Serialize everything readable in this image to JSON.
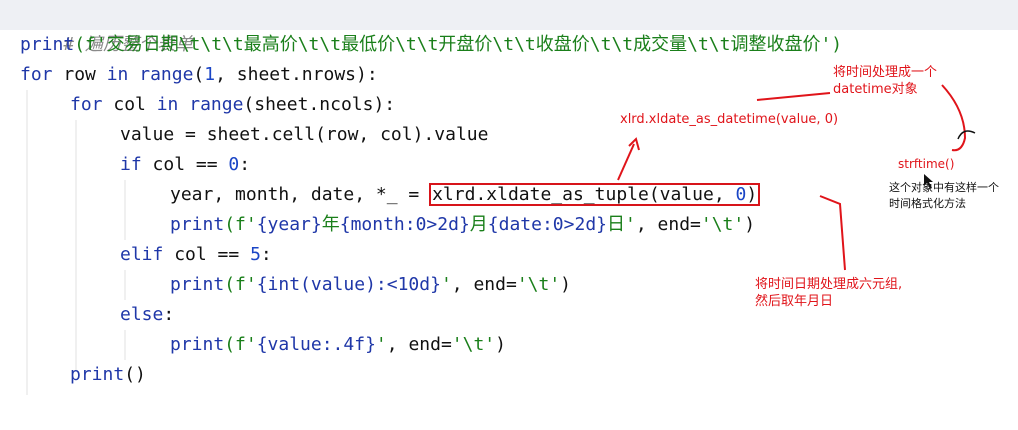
{
  "code": {
    "comment": "# 遍历整个表单",
    "print_header": {
      "fn": "print",
      "open": "(f'",
      "str": "交易日期\\t\\t\\t最高价\\t\\t最低价\\t\\t开盘价\\t\\t收盘价\\t\\t成交量\\t\\t调整收盘价",
      "close": "')"
    },
    "for_row": {
      "for": "for",
      "var": " row ",
      "in": "in",
      "range": " range",
      "args_a": "(",
      "one": "1",
      "args_b": ", sheet.nrows):"
    },
    "for_col": {
      "for": "for",
      "var": " col ",
      "in": "in",
      "range": " range",
      "args": "(sheet.ncols):"
    },
    "value_line": "value = sheet.cell(row, col).value",
    "if_col": {
      "kw": "if",
      "cond": " col == ",
      "zero": "0",
      "colon": ":"
    },
    "unpack": {
      "lhs": "year, month, date, *_ = ",
      "call": "xlrd.xldate_as_tuple(value, ",
      "zero": "0",
      "close": ")"
    },
    "print_date": {
      "fn": "print",
      "open": "(f'",
      "f1": "{year}",
      "s1": "年",
      "f2": "{month:0>2d}",
      "s2": "月",
      "f3": "{date:0>2d}",
      "s3": "日'",
      "mid": ", end=",
      "end_str": "'\\t'",
      "close": ")"
    },
    "elif_col": {
      "kw": "elif",
      "cond": " col == ",
      "five": "5",
      "colon": ":"
    },
    "print_int": {
      "fn": "print",
      "open": "(f'",
      "f1": "{int(value):<10d}",
      "s1": "'",
      "mid": ", end=",
      "end_str": "'\\t'",
      "close": ")"
    },
    "else_line": {
      "kw": "else",
      "colon": ":"
    },
    "print_value": {
      "fn": "print",
      "open": "(f'",
      "f1": "{value:.4f}",
      "s1": "'",
      "mid": ", end=",
      "end_str": "'\\t'",
      "close": ")"
    },
    "print_empty": {
      "fn": "print",
      "args": "()"
    }
  },
  "annotations": {
    "datetime_note_line1": "将时间处理成一个",
    "datetime_note_line2": "datetime对象",
    "as_datetime": "xlrd.xldate_as_datetime(value, 0)",
    "strftime": "strftime()",
    "strftime_note_line1": "这个对象中有这样一个",
    "strftime_note_line2": "时间格式化方法",
    "tuple_note_line1": "将时间日期处理成六元组,",
    "tuple_note_line2": "然后取年月日"
  },
  "colors": {
    "annotation_red": "#e0141a",
    "keyword_blue": "#1f37a8",
    "string_green": "#1a7f1a",
    "comment_gray": "#8a8a8a"
  }
}
